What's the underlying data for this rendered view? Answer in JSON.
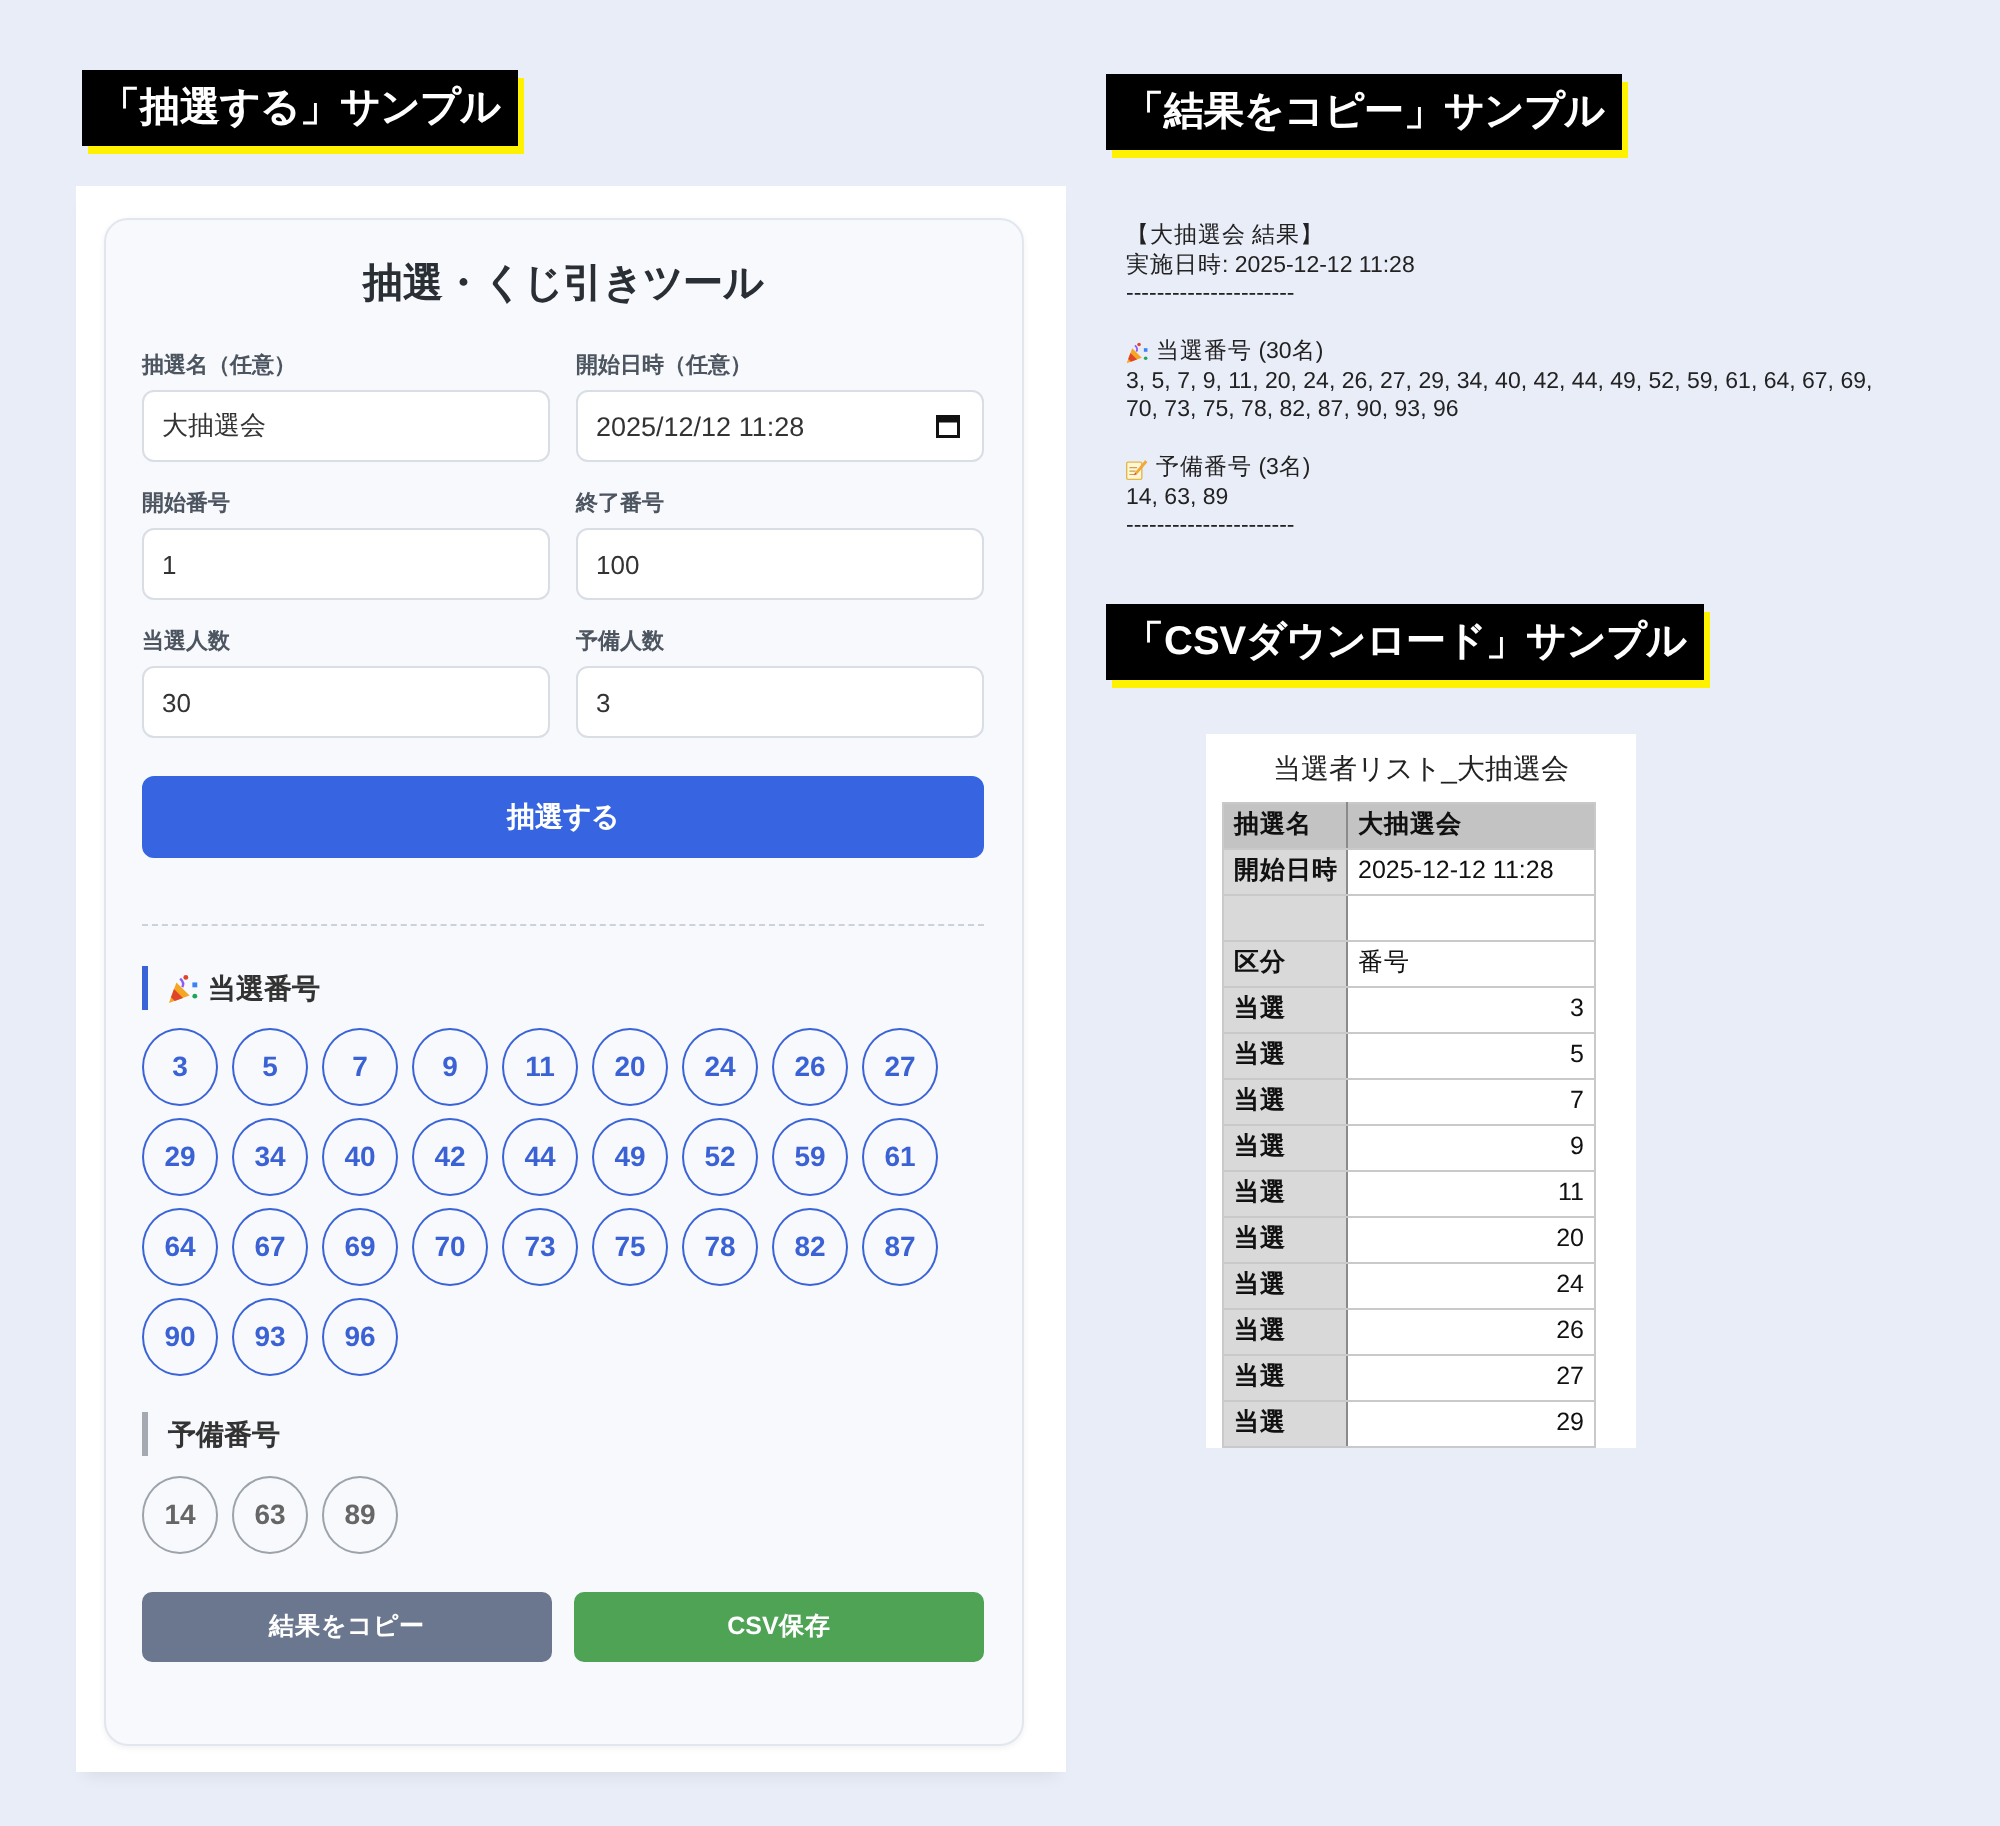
{
  "draw_sample": {
    "label": "「抽選する」サンプル",
    "tool": {
      "title": "抽選・くじ引きツール",
      "fields": [
        {
          "label": "抽選名（任意）",
          "value": "大抽選会",
          "kind": "text"
        },
        {
          "label": "開始日時（任意）",
          "value": "2025/12/12 11:28",
          "kind": "datetime"
        },
        {
          "label": "開始番号",
          "value": "1",
          "kind": "text"
        },
        {
          "label": "終了番号",
          "value": "100",
          "kind": "text"
        },
        {
          "label": "当選人数",
          "value": "30",
          "kind": "text"
        },
        {
          "label": "予備人数",
          "value": "3",
          "kind": "text"
        }
      ],
      "draw_button": "抽選する",
      "results": [
        {
          "kind": "winners",
          "heading": "当選番号",
          "numbers": [
            "3",
            "5",
            "7",
            "9",
            "11",
            "20",
            "24",
            "26",
            "27",
            "29",
            "34",
            "40",
            "42",
            "44",
            "49",
            "52",
            "59",
            "61",
            "64",
            "67",
            "69",
            "70",
            "73",
            "75",
            "78",
            "82",
            "87",
            "90",
            "93",
            "96"
          ]
        },
        {
          "kind": "reserves",
          "heading": "予備番号",
          "numbers": [
            "14",
            "63",
            "89"
          ]
        }
      ],
      "actions": [
        {
          "kind": "copy",
          "label": "結果をコピー"
        },
        {
          "kind": "csv",
          "label": "CSV保存"
        }
      ]
    }
  },
  "copy_sample": {
    "label": "「結果をコピー」サンプル",
    "header": [
      "【大抽選会 結果】",
      "実施日時: 2025-12-12 11:28",
      "----------------------"
    ],
    "sections": [
      {
        "kind": "winners",
        "heading": "当選番号 (30名)",
        "body": "3, 5, 7, 9, 11, 20, 24, 26, 27, 29, 34, 40, 42, 44, 49, 52, 59, 61, 64, 67, 69, 70, 73, 75, 78, 82, 87, 90, 93, 96"
      },
      {
        "kind": "reserves",
        "heading": "予備番号 (3名)",
        "body": "14, 63, 89"
      }
    ],
    "footer": "----------------------"
  },
  "csv_sample": {
    "label": "「CSVダウンロード」サンプル",
    "sheet": {
      "title": "当選者リスト_大抽選会",
      "rows": [
        {
          "kind": "header",
          "cells": [
            "抽選名",
            "大抽選会"
          ]
        },
        {
          "kind": "info",
          "cells": [
            "開始日時",
            "2025-12-12 11:28"
          ]
        },
        {
          "kind": "blank"
        },
        {
          "kind": "info",
          "cells": [
            "区分",
            "番号"
          ]
        },
        {
          "kind": "data",
          "cells": [
            "当選",
            "3"
          ]
        },
        {
          "kind": "data",
          "cells": [
            "当選",
            "5"
          ]
        },
        {
          "kind": "data",
          "cells": [
            "当選",
            "7"
          ]
        },
        {
          "kind": "data",
          "cells": [
            "当選",
            "9"
          ]
        },
        {
          "kind": "data",
          "cells": [
            "当選",
            "11"
          ]
        },
        {
          "kind": "data",
          "cells": [
            "当選",
            "20"
          ]
        },
        {
          "kind": "data",
          "cells": [
            "当選",
            "24"
          ]
        },
        {
          "kind": "data",
          "cells": [
            "当選",
            "26"
          ]
        },
        {
          "kind": "data",
          "cells": [
            "当選",
            "27"
          ]
        },
        {
          "kind": "data",
          "cells": [
            "当選",
            "29"
          ]
        }
      ]
    }
  }
}
